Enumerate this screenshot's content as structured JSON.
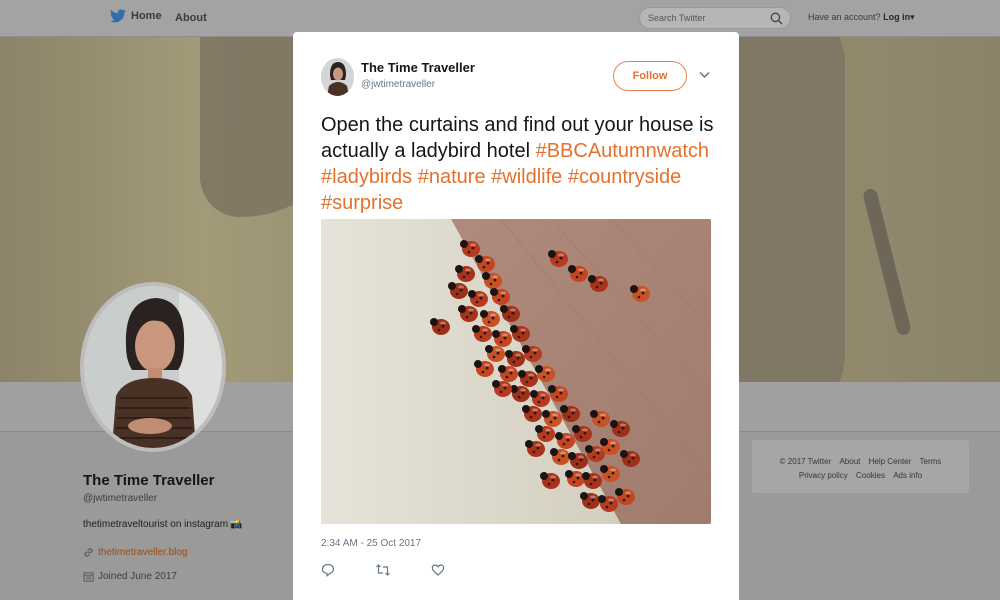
{
  "nav": {
    "home_label": "Home",
    "about_label": "About",
    "search_placeholder": "Search Twitter",
    "account_prompt": "Have an account?",
    "login_label": "Log in",
    "login_caret": "▾"
  },
  "profile": {
    "name": "The Time Traveller",
    "handle": "@jwtimetraveller",
    "bio": "thetimetraveltourist on instagram",
    "bio_emoji": "📸",
    "link": "thetimetraveller.blog",
    "joined": "Joined June 2017"
  },
  "footer": {
    "links": [
      "© 2017 Twitter",
      "About",
      "Help Center",
      "Terms",
      "Privacy policy",
      "Cookies",
      "Ads info"
    ]
  },
  "tweet": {
    "author_name": "The Time Traveller",
    "author_handle": "@jwtimetraveller",
    "follow_label": "Follow",
    "text_plain": "Open the curtains and find out your house is actually a ladybird hotel ",
    "hashtags": [
      "#BBCAutumnwatch",
      "#ladybirds",
      "#nature",
      "#wildlife",
      "#countryside",
      "#surprise"
    ],
    "timestamp": "2:34 AM - 25 Oct 2017"
  },
  "colors": {
    "accent": "#e4712d",
    "nav_bg": "#a3a3a3",
    "overlay_bg": "#9a9a98",
    "modal_bg": "#ffffff",
    "ladybird_red": "#b63a1e"
  },
  "icons": {
    "home": "twitter-bird-icon",
    "search": "magnifier-icon",
    "link": "link-icon",
    "calendar": "calendar-icon",
    "reply": "reply-icon",
    "retweet": "retweet-icon",
    "like": "heart-icon",
    "more": "chevron-down-icon"
  }
}
